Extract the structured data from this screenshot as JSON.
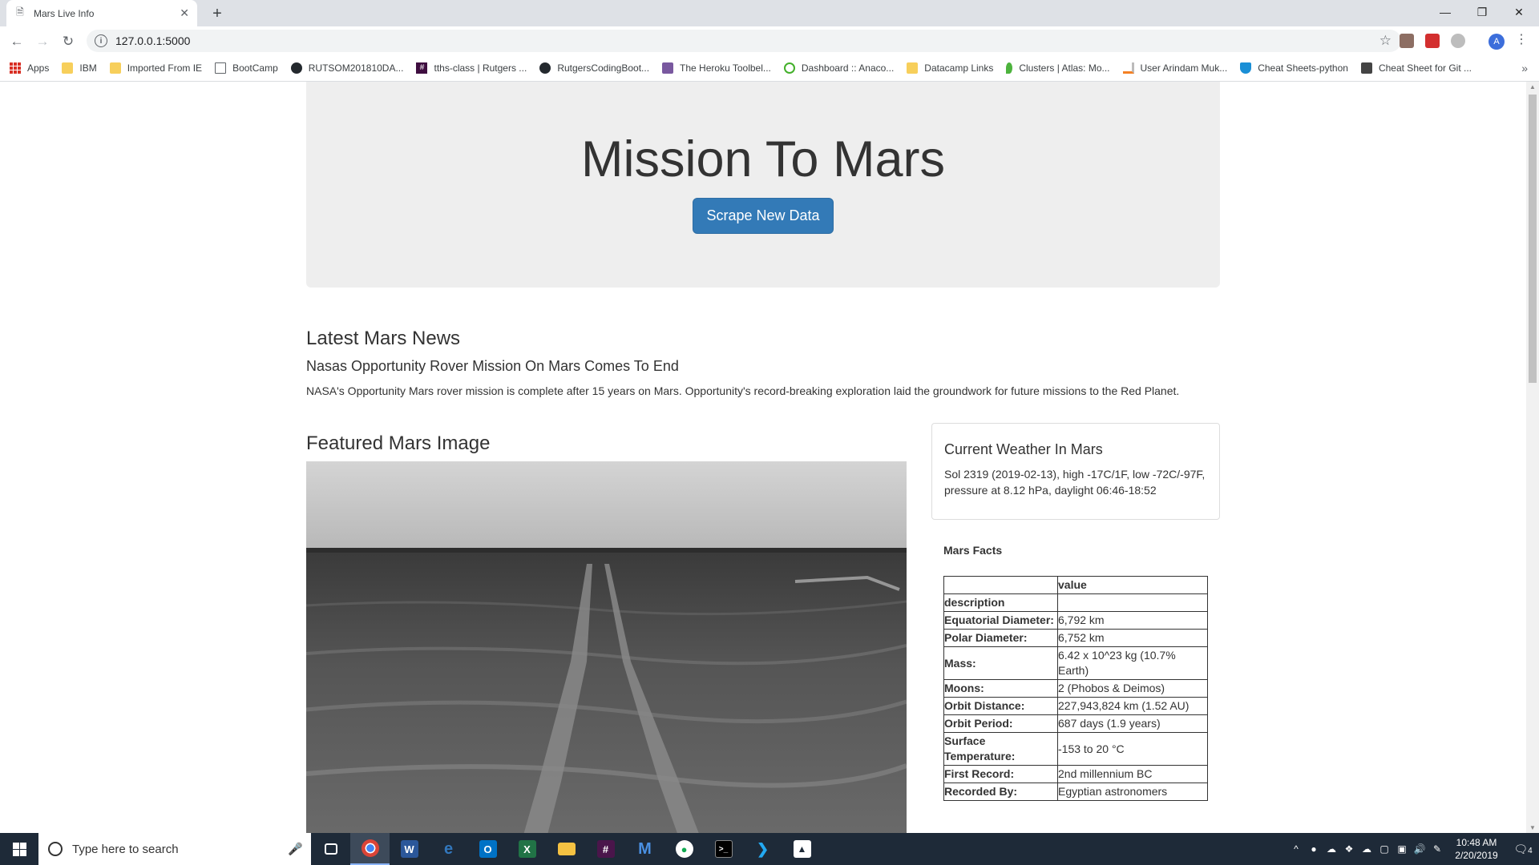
{
  "browser": {
    "tab_title": "Mars Live Info",
    "url": "127.0.0.1:5000",
    "avatar_letter": "A",
    "bookmarks": [
      {
        "label": "Apps",
        "icon": "apps-grid-icon"
      },
      {
        "label": "IBM",
        "icon": "folder-icon"
      },
      {
        "label": "Imported From IE",
        "icon": "folder-icon"
      },
      {
        "label": "BootCamp",
        "icon": "page-icon"
      },
      {
        "label": "RUTSOM201810DA...",
        "icon": "github-icon"
      },
      {
        "label": "tths-class | Rutgers ...",
        "icon": "slack-hash-icon"
      },
      {
        "label": "RutgersCodingBoot...",
        "icon": "github-icon"
      },
      {
        "label": "The Heroku Toolbel...",
        "icon": "heroku-icon"
      },
      {
        "label": "Dashboard :: Anaco...",
        "icon": "anaconda-icon"
      },
      {
        "label": "Datacamp Links",
        "icon": "folder-icon"
      },
      {
        "label": "Clusters | Atlas: Mo...",
        "icon": "mongodb-leaf-icon"
      },
      {
        "label": "User Arindam Muk...",
        "icon": "stackoverflow-icon"
      },
      {
        "label": "Cheat Sheets-python",
        "icon": "shield-icon"
      },
      {
        "label": "Cheat Sheet for Git ...",
        "icon": "cube-icon"
      }
    ]
  },
  "page": {
    "heading": "Mission To Mars",
    "scrape_button": "Scrape New Data",
    "news_section_title": "Latest Mars News",
    "news_title": "Nasas Opportunity Rover Mission On Mars Comes To End",
    "news_paragraph": "NASA's Opportunity Mars rover mission is complete after 15 years on Mars. Opportunity's record-breaking exploration laid the groundwork for future missions to the Red Planet.",
    "featured_title": "Featured Mars Image",
    "weather_title": "Current Weather In Mars",
    "weather_text": "Sol 2319 (2019-02-13), high -17C/1F, low -72C/-97F, pressure at 8.12 hPa, daylight 06:46-18:52",
    "facts_title": "Mars Facts",
    "facts_header_value": "value",
    "facts_header_description": "description",
    "facts": [
      {
        "k": "Equatorial Diameter:",
        "v": "6,792 km"
      },
      {
        "k": "Polar Diameter:",
        "v": "6,752 km"
      },
      {
        "k": "Mass:",
        "v": "6.42 x 10^23 kg (10.7% Earth)"
      },
      {
        "k": "Moons:",
        "v": "2 (Phobos & Deimos)"
      },
      {
        "k": "Orbit Distance:",
        "v": "227,943,824 km (1.52 AU)"
      },
      {
        "k": "Orbit Period:",
        "v": "687 days (1.9 years)"
      },
      {
        "k": "Surface Temperature:",
        "v": "-153 to 20 °C"
      },
      {
        "k": "First Record:",
        "v": "2nd millennium BC"
      },
      {
        "k": "Recorded By:",
        "v": "Egyptian astronomers"
      }
    ]
  },
  "taskbar": {
    "search_placeholder": "Type here to search",
    "time": "10:48 AM",
    "date": "2/20/2019",
    "notification_count": "4"
  }
}
